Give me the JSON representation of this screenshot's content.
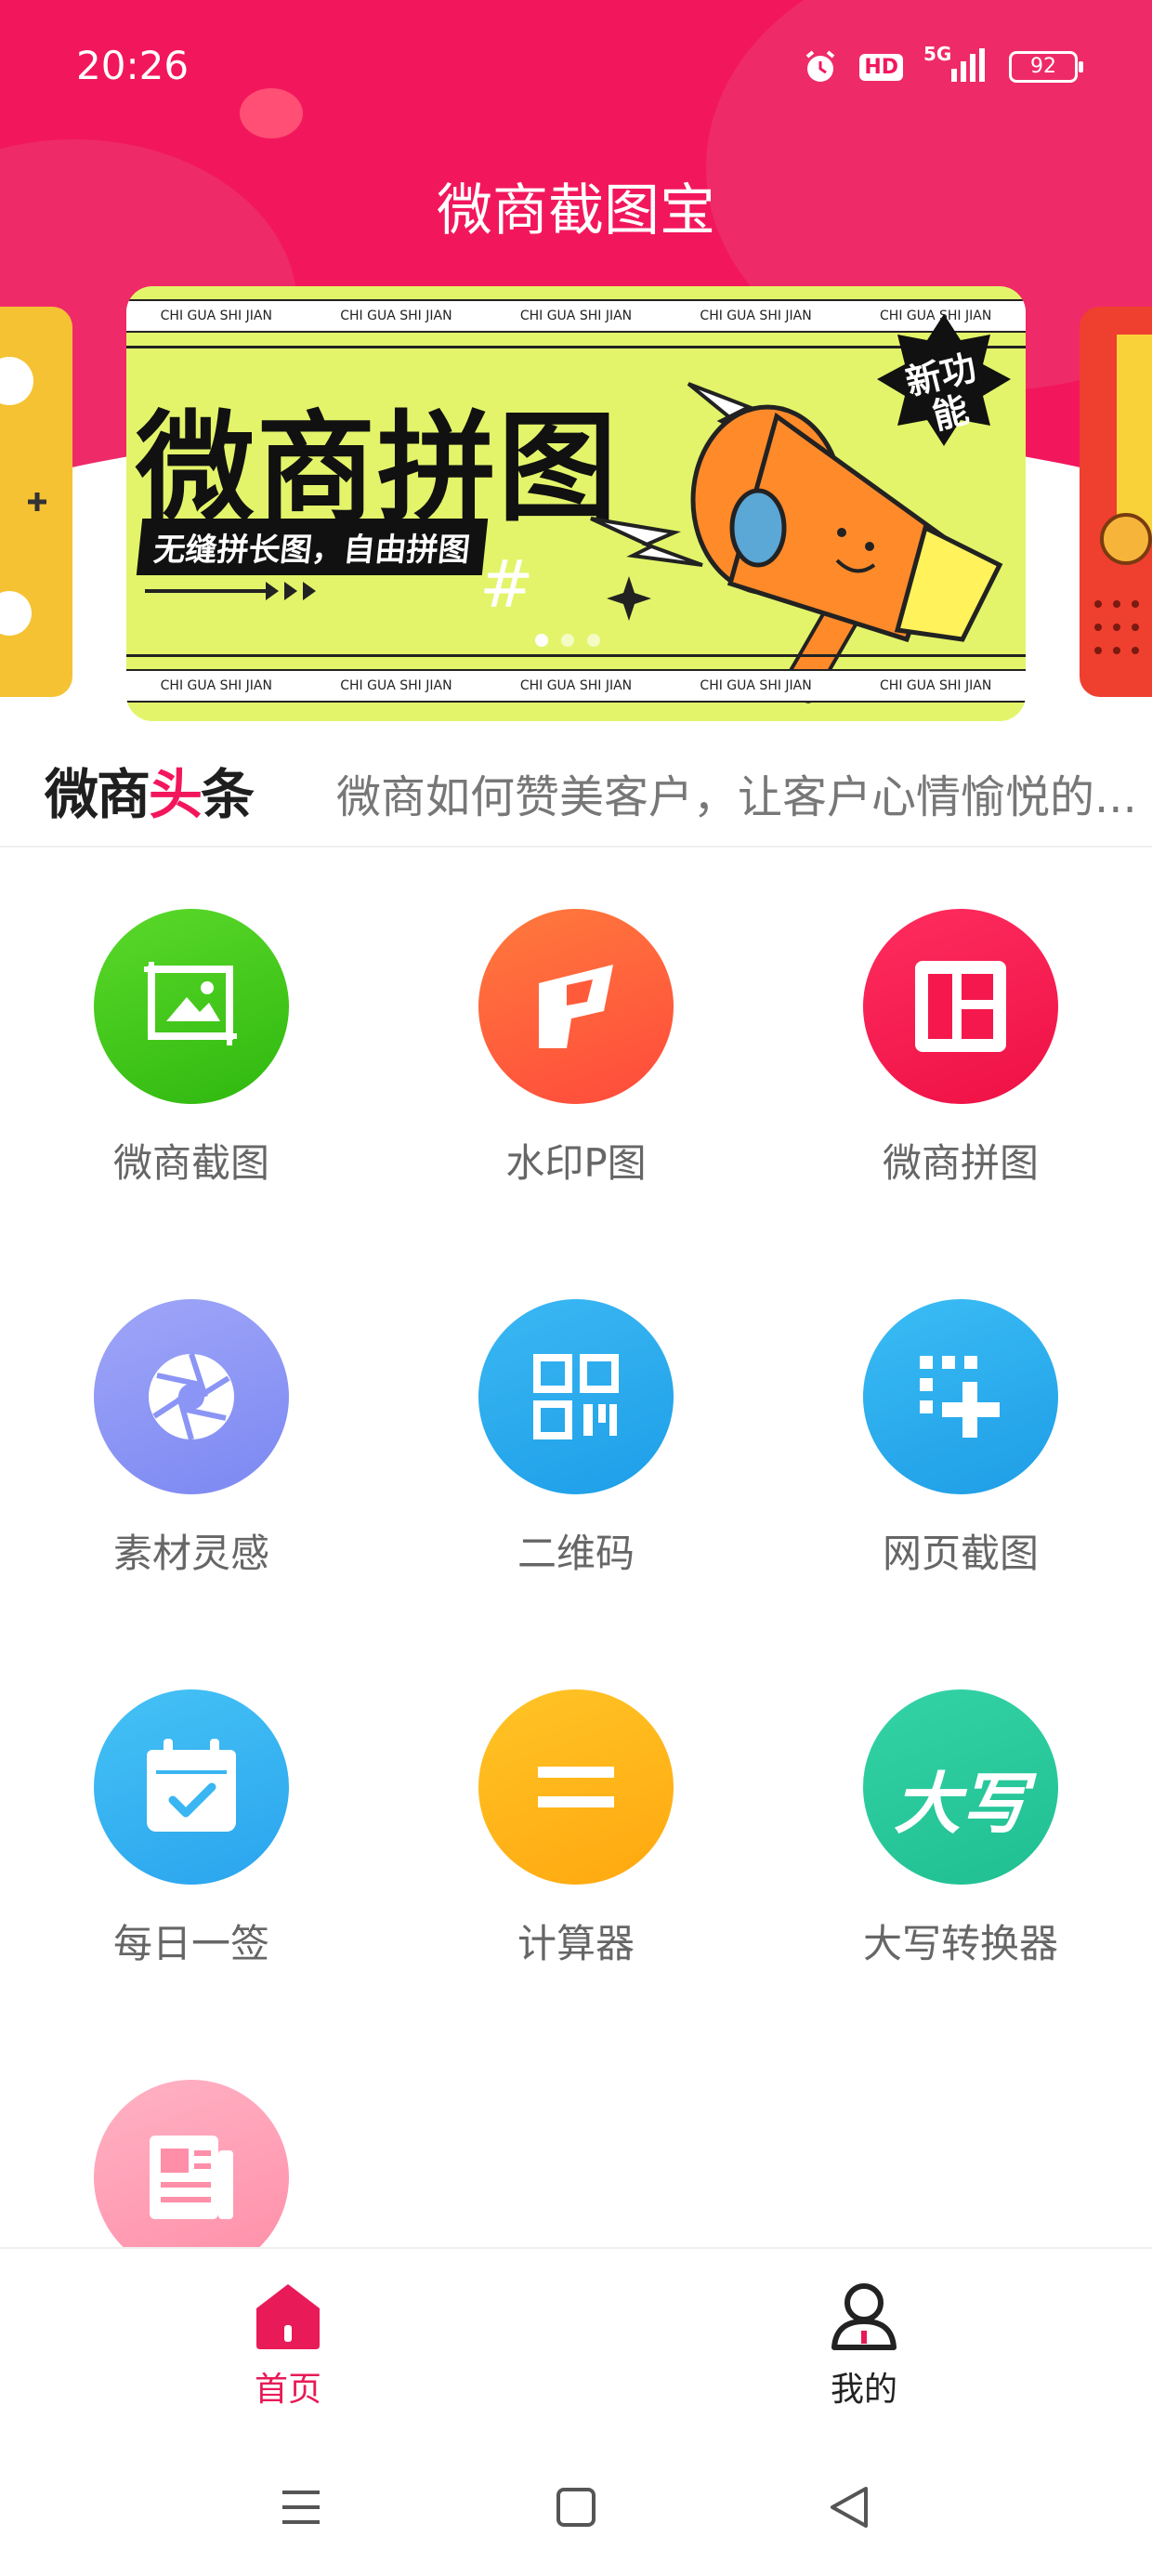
{
  "status_bar": {
    "time": "20:26",
    "network": "5G",
    "hd": "HD",
    "battery": "92"
  },
  "app": {
    "title": "微商截图宝"
  },
  "banner": {
    "strip_text": "CHI GUA SHI JIAN",
    "headline": "微商拼图",
    "subline": "无缝拼长图，自由拼图",
    "badge": "新功能"
  },
  "ticker": {
    "brand_left": "微商",
    "brand_accent": "头",
    "brand_right": "条",
    "headline": "微商如何赞美客户，让客户心情愉悦的..."
  },
  "tools": [
    {
      "label": "微商截图",
      "icon": "image-edit-icon",
      "color": "#3fcd1b"
    },
    {
      "label": "水印P图",
      "icon": "watermark-icon",
      "color": "#ff5b3a"
    },
    {
      "label": "微商拼图",
      "icon": "collage-icon",
      "color": "#f5184d"
    },
    {
      "label": "素材灵感",
      "icon": "aperture-icon",
      "color": "#8b95f5"
    },
    {
      "label": "二维码",
      "icon": "qr-code-icon",
      "color": "#2eaaf0"
    },
    {
      "label": "网页截图",
      "icon": "web-capture-icon",
      "color": "#2eaaf0"
    },
    {
      "label": "每日一签",
      "icon": "calendar-check-icon",
      "color": "#3ab6f2"
    },
    {
      "label": "计算器",
      "icon": "equals-icon",
      "color": "#ffb414"
    },
    {
      "label": "大写转换器",
      "icon": "uppercase-text-icon",
      "color": "#27c99d",
      "glyph": "大写"
    },
    {
      "label": "",
      "icon": "newspaper-icon",
      "color": "#ff9eb4"
    }
  ],
  "bottom_nav": [
    {
      "label": "首页",
      "icon": "home-icon",
      "active": true,
      "color": "#e81a57"
    },
    {
      "label": "我的",
      "icon": "user-icon",
      "active": false,
      "color": "#222222"
    }
  ],
  "system_nav": [
    "menu-icon",
    "home-square-icon",
    "back-triangle-icon"
  ]
}
